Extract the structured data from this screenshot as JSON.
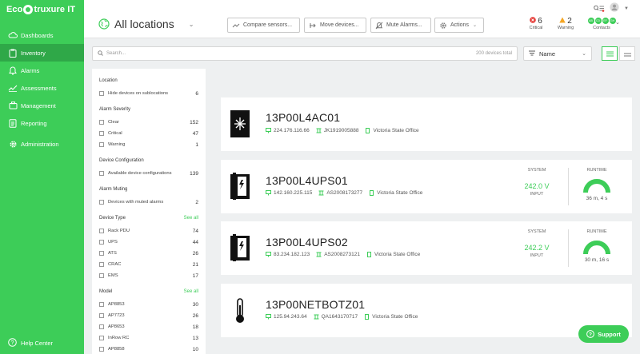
{
  "app": {
    "logo_text_a": "Eco",
    "logo_text_b": "truxure IT"
  },
  "sidebar": {
    "items": [
      {
        "label": "Dashboards",
        "icon": "cloud-icon"
      },
      {
        "label": "Inventory",
        "icon": "clipboard-icon",
        "active": true
      },
      {
        "label": "Alarms",
        "icon": "bell-icon"
      },
      {
        "label": "Assessments",
        "icon": "trend-icon"
      },
      {
        "label": "Management",
        "icon": "briefcase-icon"
      },
      {
        "label": "Reporting",
        "icon": "report-icon"
      },
      {
        "label": "Administration",
        "icon": "gear-icon"
      }
    ],
    "help_label": "Help Center"
  },
  "header": {
    "location": "All locations",
    "buttons": {
      "compare": "Compare sensors...",
      "move": "Move devices...",
      "mute": "Mute Alarms...",
      "actions": "Actions"
    },
    "critical": {
      "count": "6",
      "label": "Critical"
    },
    "warning": {
      "count": "2",
      "label": "Warning"
    },
    "contacts": {
      "label": "Contacts",
      "dots": [
        "AB",
        "CD",
        "EF",
        "GH"
      ]
    }
  },
  "search": {
    "placeholder": "Search...",
    "count": "200 devices total"
  },
  "sort": {
    "selected": "Name"
  },
  "filters": {
    "location": {
      "title": "Location",
      "rows": [
        {
          "label": "Hide devices on sublocations",
          "count": "6"
        }
      ]
    },
    "severity": {
      "title": "Alarm Severity",
      "rows": [
        {
          "label": "Clear",
          "count": "152"
        },
        {
          "label": "Critical",
          "count": "47"
        },
        {
          "label": "Warning",
          "count": "1"
        }
      ]
    },
    "config": {
      "title": "Device Configuration",
      "rows": [
        {
          "label": "Available device configurations",
          "count": "139"
        }
      ]
    },
    "muting": {
      "title": "Alarm Muting",
      "rows": [
        {
          "label": "Devices with muted alarms",
          "count": "2"
        }
      ]
    },
    "devtype": {
      "title": "Device Type",
      "see_all": "See all",
      "rows": [
        {
          "label": "Rack PDU",
          "count": "74"
        },
        {
          "label": "UPS",
          "count": "44"
        },
        {
          "label": "ATS",
          "count": "26"
        },
        {
          "label": "CRAC",
          "count": "21"
        },
        {
          "label": "EMS",
          "count": "17"
        }
      ]
    },
    "model": {
      "title": "Model",
      "see_all": "See all",
      "rows": [
        {
          "label": "AP8853",
          "count": "30"
        },
        {
          "label": "AP7723",
          "count": "26"
        },
        {
          "label": "AP8653",
          "count": "18"
        },
        {
          "label": "InRow RC",
          "count": "13"
        },
        {
          "label": "AP8858",
          "count": "10"
        }
      ]
    }
  },
  "devices": [
    {
      "name": "13P00L4AC01",
      "ip": "224.176.116.66",
      "serial": "JK1919005888",
      "location": "Victoria State Office",
      "icon": "cooling-unit-icon"
    },
    {
      "name": "13P00L4UPS01",
      "ip": "142.160.225.115",
      "serial": "AS2008173277",
      "location": "Victoria State Office",
      "icon": "ups-icon",
      "system_label": "SYSTEM",
      "voltage": "242.0 V",
      "voltage_label": "INPUT",
      "runtime_label": "RUNTIME",
      "runtime": "36 m, 4 s",
      "runtime_level": 1.0
    },
    {
      "name": "13P00L4UPS02",
      "ip": "83.234.182.123",
      "serial": "AS2008273121",
      "location": "Victoria State Office",
      "icon": "ups-icon",
      "system_label": "SYSTEM",
      "voltage": "242.2 V",
      "voltage_label": "INPUT",
      "runtime_label": "RUNTIME",
      "runtime": "30 m, 16 s",
      "runtime_level": 1.0
    },
    {
      "name": "13P00NETBOTZ01",
      "ip": "125.94.243.64",
      "serial": "QA1643170717",
      "location": "Victoria State Office",
      "icon": "thermometer-icon"
    }
  ],
  "support": {
    "label": "Support"
  },
  "colors": {
    "brand": "#3dcd58",
    "critical": "#e53935",
    "warning": "#f5a623"
  }
}
